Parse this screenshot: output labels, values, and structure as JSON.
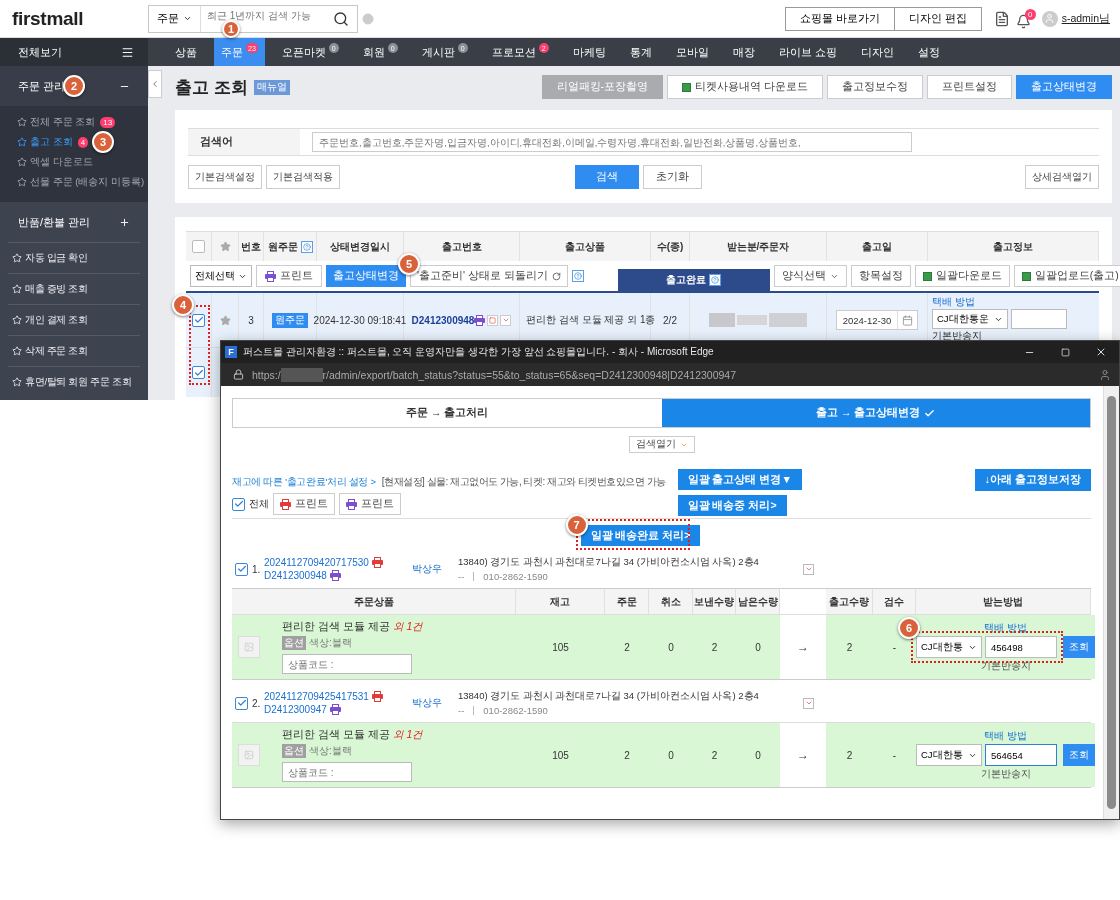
{
  "header": {
    "logo": "firstmall",
    "search": {
      "scope": "주문",
      "placeholder": "최근 1년까지 검색 가능",
      "marker": "1"
    },
    "links": [
      "쇼핑몰 바로가기",
      "디자인 편집"
    ],
    "notification_count": "0",
    "user": "s-admin님"
  },
  "nav": {
    "menu_label": "전체보기",
    "tabs": [
      {
        "label": "상품",
        "selected": false
      },
      {
        "label": "주문",
        "selected": true,
        "badge": "23",
        "color": "#ff3d6e"
      },
      {
        "label": "오픈마켓",
        "selected": false,
        "badge": "0",
        "color": "#8a8f98"
      },
      {
        "label": "회원",
        "selected": false,
        "badge": "0",
        "color": "#8a8f98"
      },
      {
        "label": "게시판",
        "selected": false,
        "badge": "0",
        "color": "#8a8f98"
      },
      {
        "label": "프로모션",
        "selected": false,
        "badge": "2",
        "color": "#ff3d6e"
      },
      {
        "label": "마케팅",
        "selected": false
      },
      {
        "label": "통계",
        "selected": false
      },
      {
        "label": "모바일",
        "selected": false
      },
      {
        "label": "매장",
        "selected": false
      },
      {
        "label": "라이브 쇼핑",
        "selected": false
      },
      {
        "label": "디자인",
        "selected": false
      },
      {
        "label": "설정",
        "selected": false
      }
    ]
  },
  "sidebar": {
    "sections": [
      {
        "title": "주문 관리",
        "expanded": true,
        "marker": "2",
        "items": [
          {
            "label": "전체 주문 조회",
            "badge": "13",
            "selected": false
          },
          {
            "label": "출고 조회",
            "badge": "4",
            "selected": true,
            "marker": "3"
          },
          {
            "label": "엑셀 다운로드",
            "selected": false
          },
          {
            "label": "선물 주문 (배송지 미등록)",
            "selected": false
          }
        ]
      },
      {
        "title": "반품/환불 관리",
        "expanded": false
      }
    ],
    "links": [
      "자동 입금 확인",
      "매출 증빙 조회",
      "개인 결제 조회",
      "삭제 주문 조회",
      "휴면/탈퇴 회원 주문 조회"
    ]
  },
  "page": {
    "title": "출고 조회",
    "badge": "매뉴얼",
    "actions": [
      {
        "label": "리얼패킹-포장촬영",
        "kind": "muted"
      },
      {
        "label": "티켓사용내역 다운로드",
        "kind": "excel"
      },
      {
        "label": "출고정보수정",
        "kind": "plain"
      },
      {
        "label": "프린트설정",
        "kind": "plain"
      },
      {
        "label": "출고상태변경",
        "kind": "primary"
      }
    ]
  },
  "search_panel": {
    "label": "검색어",
    "placeholder": "주문번호,출고번호,주문자명,입금자명,아이디,휴대전화,이메일,수령자명,휴대전화,일반전화,상품명,상품번호,",
    "left_buttons": [
      "기본검색설정",
      "기본검색적용"
    ],
    "search_button": "검색",
    "reset_button": "초기화",
    "detail_button": "상세검색열기"
  },
  "table": {
    "select_all_checked": false,
    "marker": "4",
    "columns": [
      "번호",
      "원주문",
      "상태변경일시",
      "출고번호",
      "출고상품",
      "수(종)",
      "받는분/주문자",
      "출고일",
      "출고정보"
    ],
    "toolbar": {
      "select": "전체선택",
      "print": "프린트",
      "change": {
        "label": "출고상태변경",
        "marker": "5"
      },
      "revert": "'출고준비' 상태로 되돌리기",
      "status_tab": "출고완료",
      "right": [
        {
          "label": "양식선택",
          "kind": "dropdown"
        },
        {
          "label": "항목설정",
          "kind": "plain"
        },
        {
          "label": "일괄다운로드",
          "kind": "excel"
        },
        {
          "label": "일괄업로드(출고)",
          "kind": "excel"
        }
      ]
    },
    "rows": [
      {
        "checked": true,
        "number": "3",
        "tag": "원주문",
        "changed_at": "2024-12-30 09:18:41",
        "export_no": "D2412300948",
        "product": "편리한 검색 모듈 제공 외 1종",
        "count": "2/2",
        "date": "2024-12-30",
        "delivery_label": "택배 방법",
        "courier": "CJ대한통운",
        "return_label": "기본반송지"
      },
      {
        "checked": true
      }
    ]
  },
  "popup": {
    "favicon": "F",
    "title": "퍼스트몰 관리자환경 :: 퍼스트몰, 오직 운영자만을 생각한 가장 앞선 쇼핑몰입니다. - 회사 - Microsoft Edge",
    "url_start": "https:/",
    "url_end": "r/admin/export/batch_status?status=55&to_status=65&seq=D2412300948|D2412300947",
    "steps": [
      {
        "label": "주문 → 출고처리",
        "selected": false
      },
      {
        "label": "출고 → 출고상태변경",
        "selected": true
      }
    ],
    "search_toggle": "검색열기",
    "setting_link": "재고에 따른 '출고완료'처리 설정 >",
    "setting_note": "[현재설정] 실물: 재고없어도 가능,  티켓: 재고와 티켓번호있으면 가능",
    "select_all": {
      "label": "전체",
      "checked": true
    },
    "print_buttons": [
      {
        "label": "프린트",
        "color": "#e23b3b"
      },
      {
        "label": "프린트",
        "color": "#7b4fd0"
      }
    ],
    "bulk_buttons": [
      {
        "label": "일괄 출고상태 변경▼"
      },
      {
        "label": "일괄 배송중 처리>"
      },
      {
        "label": "일괄 배송완료 처리>",
        "marker": "7"
      }
    ],
    "save_button": "↓아래 출고정보저장",
    "columns": [
      "주문상품",
      "재고",
      "주문",
      "취소",
      "보낸수량",
      "남은수량",
      "출고수량",
      "검수",
      "받는방법"
    ],
    "orders": [
      {
        "checked": true,
        "index": "1.",
        "order_no": "2024112709420717530",
        "export_no": "D2412300948",
        "recipient": "박상우",
        "address": "13840) 경기도 과천시 과천대로7나길 34 (가비아컨소시엄 사옥) 2층4",
        "phone_prefix": "--",
        "phone": "010-2862-1590",
        "marker": "6",
        "item": {
          "name": "편리한 검색 모듈 제공",
          "extra": "외 1건",
          "option_tag": "옵션",
          "option": "색상:블랙",
          "code_placeholder": "상품코드 :",
          "stock": "105",
          "ordered": "2",
          "cancelled": "0",
          "sent": "2",
          "remaining": "0",
          "arrow": "→",
          "ship_qty": "2",
          "inspection": "-",
          "delivery_label": "택배 방법",
          "courier": "CJ대한통",
          "tracking": "456498",
          "focused": false,
          "lookup": "조회",
          "return_label": "기본반송지"
        }
      },
      {
        "checked": true,
        "index": "2.",
        "order_no": "2024112709425417531",
        "export_no": "D2412300947",
        "recipient": "박상우",
        "address": "13840) 경기도 과천시 과천대로7나길 34 (가비아컨소시엄 사옥) 2층4",
        "phone_prefix": "--",
        "phone": "010-2862-1590",
        "item": {
          "name": "편리한 검색 모듈 제공",
          "extra": "외 1건",
          "option_tag": "옵션",
          "option": "색상:블랙",
          "code_placeholder": "상품코드 :",
          "stock": "105",
          "ordered": "2",
          "cancelled": "0",
          "sent": "2",
          "remaining": "0",
          "arrow": "→",
          "ship_qty": "2",
          "inspection": "-",
          "delivery_label": "택배 방법",
          "courier": "CJ대한통",
          "tracking": "564654",
          "focused": true,
          "lookup": "조회",
          "return_label": "기본반송지"
        }
      }
    ]
  }
}
